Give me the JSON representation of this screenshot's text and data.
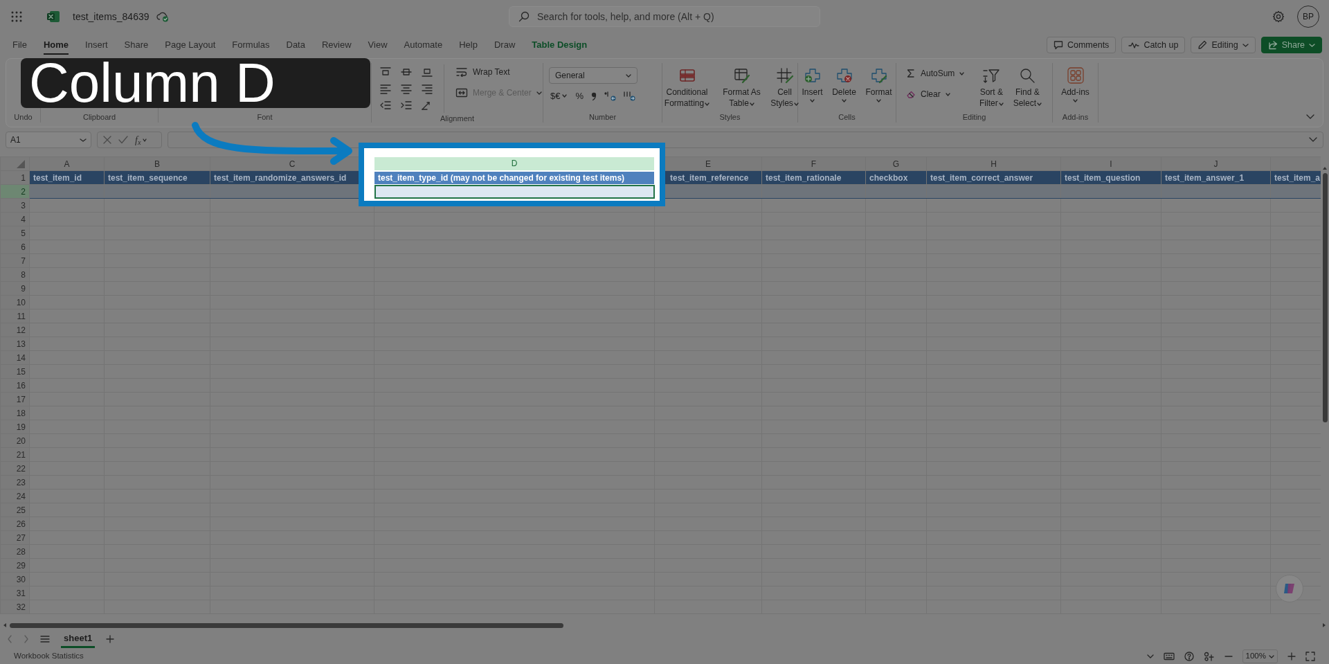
{
  "app_bar": {
    "file_name": "test_items_84639",
    "search_placeholder": "Search for tools, help, and more (Alt + Q)",
    "avatar_initials": "BP"
  },
  "ribbon_tabs": [
    {
      "label": "File",
      "selected": false,
      "kind": "tab"
    },
    {
      "label": "Home",
      "selected": true,
      "kind": "tab"
    },
    {
      "label": "Insert",
      "selected": false,
      "kind": "tab"
    },
    {
      "label": "Share",
      "selected": false,
      "kind": "tab"
    },
    {
      "label": "Page Layout",
      "selected": false,
      "kind": "tab"
    },
    {
      "label": "Formulas",
      "selected": false,
      "kind": "tab"
    },
    {
      "label": "Data",
      "selected": false,
      "kind": "tab"
    },
    {
      "label": "Review",
      "selected": false,
      "kind": "tab"
    },
    {
      "label": "View",
      "selected": false,
      "kind": "tab"
    },
    {
      "label": "Automate",
      "selected": false,
      "kind": "tab"
    },
    {
      "label": "Help",
      "selected": false,
      "kind": "tab"
    },
    {
      "label": "Draw",
      "selected": false,
      "kind": "tab"
    },
    {
      "label": "Table Design",
      "selected": false,
      "kind": "contextual"
    }
  ],
  "action_buttons": [
    {
      "label": "Comments",
      "kind": "comments"
    },
    {
      "label": "Catch up",
      "kind": "catchup"
    },
    {
      "label": "Editing",
      "kind": "mode"
    },
    {
      "label": "Share",
      "kind": "share"
    }
  ],
  "ribbon_groups": [
    {
      "kind": "label_only",
      "label": "Undo"
    },
    {
      "kind": "label_only",
      "label": "Clipboard"
    },
    {
      "kind": "label_only",
      "label": "Font"
    },
    {
      "kind": "alignment",
      "label": "Alignment",
      "items": [
        {
          "label": "Wrap Text",
          "disabled": false
        },
        {
          "label": "Merge & Center",
          "disabled": true
        }
      ]
    },
    {
      "kind": "number",
      "label": "Number",
      "format": "General",
      "currency": "$€",
      "percent": "%"
    },
    {
      "kind": "large",
      "label": "Styles",
      "items": [
        {
          "label": "Conditional Formatting"
        },
        {
          "label": "Format As Table"
        },
        {
          "label": "Cell Styles"
        }
      ]
    },
    {
      "kind": "stacked",
      "label": "Cells",
      "items": [
        {
          "label": "Insert"
        },
        {
          "label": "Delete"
        },
        {
          "label": "Format"
        }
      ]
    },
    {
      "kind": "editing",
      "label": "Editing",
      "small_items": [
        {
          "label": "AutoSum"
        },
        {
          "label": "Clear"
        }
      ],
      "items": [
        {
          "label": "Sort & Filter"
        },
        {
          "label": "Find & Select"
        }
      ]
    },
    {
      "kind": "stacked",
      "label": "Add-ins",
      "items": [
        {
          "label": "Add-ins"
        }
      ]
    }
  ],
  "formula_bar": {
    "name_box": "A1",
    "function_label": "f$_{x}$"
  },
  "sheet": {
    "columns": [
      {
        "letter": "A",
        "header": "test_item_id",
        "spotlight": false
      },
      {
        "letter": "B",
        "header": "test_item_sequence",
        "spotlight": false
      },
      {
        "letter": "C",
        "header": "test_item_randomize_answers_id",
        "spotlight": false
      },
      {
        "letter": "D",
        "header": "test_item_type_id (may not be changed for existing test items)",
        "spotlight": true
      },
      {
        "letter": "E",
        "header": "test_item_reference",
        "spotlight": false
      },
      {
        "letter": "F",
        "header": "test_item_rationale",
        "spotlight": false
      },
      {
        "letter": "G",
        "header": "checkbox",
        "spotlight": false
      },
      {
        "letter": "H",
        "header": "test_item_correct_answer",
        "spotlight": false
      },
      {
        "letter": "I",
        "header": "test_item_question",
        "spotlight": false
      },
      {
        "letter": "J",
        "header": "test_item_answer_1",
        "spotlight": false
      },
      {
        "header": "test_item_a",
        "spotlight": false
      }
    ],
    "rows": [
      {
        "number": "1",
        "selected": false
      },
      {
        "number": "2",
        "selected": true
      },
      {
        "number": "3",
        "selected": false
      },
      {
        "number": "4",
        "selected": false
      },
      {
        "number": "5",
        "selected": false
      },
      {
        "number": "6",
        "selected": false
      },
      {
        "number": "7",
        "selected": false
      },
      {
        "number": "8",
        "selected": false
      },
      {
        "number": "9",
        "selected": false
      },
      {
        "number": "10",
        "selected": false
      },
      {
        "number": "11",
        "selected": false
      },
      {
        "number": "12",
        "selected": false
      },
      {
        "number": "13",
        "selected": false
      },
      {
        "number": "14",
        "selected": false
      },
      {
        "number": "15",
        "selected": false
      },
      {
        "number": "16",
        "selected": false
      },
      {
        "number": "17",
        "selected": false
      },
      {
        "number": "18",
        "selected": false
      },
      {
        "number": "19",
        "selected": false
      },
      {
        "number": "20",
        "selected": false
      },
      {
        "number": "21",
        "selected": false
      },
      {
        "number": "22",
        "selected": false
      },
      {
        "number": "23",
        "selected": false
      },
      {
        "number": "24",
        "selected": false
      },
      {
        "number": "25",
        "selected": false
      },
      {
        "number": "26",
        "selected": false
      },
      {
        "number": "27",
        "selected": false
      },
      {
        "number": "28",
        "selected": false
      },
      {
        "number": "29",
        "selected": false
      },
      {
        "number": "30",
        "selected": false
      },
      {
        "number": "31",
        "selected": false
      },
      {
        "number": "32",
        "selected": false
      }
    ]
  },
  "sheet_tabs": [
    {
      "label": "sheet1",
      "selected": true
    }
  ],
  "status_bar": {
    "left": "Workbook Statistics",
    "zoom": "100%"
  },
  "callout": {
    "text": "Column D"
  }
}
